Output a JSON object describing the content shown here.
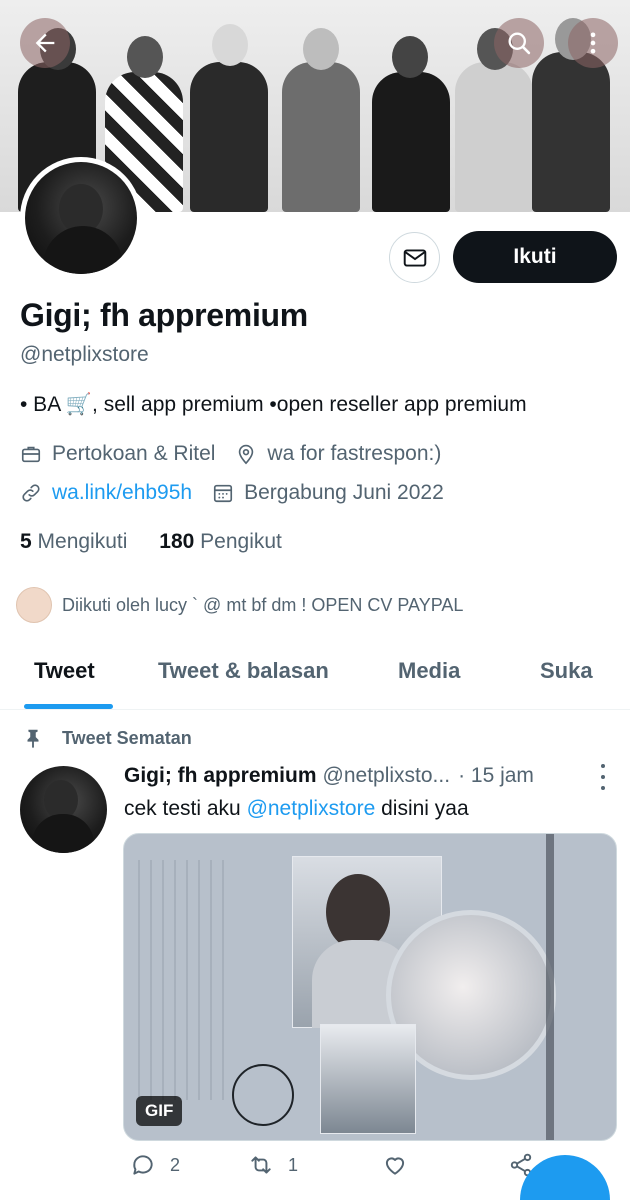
{
  "profile": {
    "name": "Gigi; fh appremium",
    "handle": "@netplixstore",
    "bio": "• BA 🛒, sell app premium •open reseller app premium",
    "category": "Pertokoan & Ritel",
    "location": "wa for fastrespon:)",
    "link": "wa.link/ehb95h",
    "joined": "Bergabung Juni 2022",
    "following_count": "5",
    "following_label": "Mengikuti",
    "followers_count": "180",
    "followers_label": "Pengikut",
    "followed_by": "Diikuti oleh lucy ` @ mt bf dm ! OPEN CV PAYPAL",
    "follow_button": "Ikuti"
  },
  "tabs": [
    {
      "label": "Tweet",
      "active": true
    },
    {
      "label": "Tweet & balasan",
      "active": false
    },
    {
      "label": "Media",
      "active": false
    },
    {
      "label": "Suka",
      "active": false
    }
  ],
  "pinned_tweet": {
    "pinned_label": "Tweet Sematan",
    "author_name": "Gigi; fh appremium",
    "author_handle": "@netplixsto...",
    "time": "· 15 jam",
    "text_prefix": "cek testi aku ",
    "text_mention": "@netplixstore",
    "text_suffix": " disini yaa",
    "media_badge": "GIF",
    "reply_count": "2",
    "retweet_count": "1"
  },
  "colors": {
    "accent": "#1d9bf0",
    "text_primary": "#0f1419",
    "text_secondary": "#536471",
    "follow_button_bg": "#0f1419"
  }
}
